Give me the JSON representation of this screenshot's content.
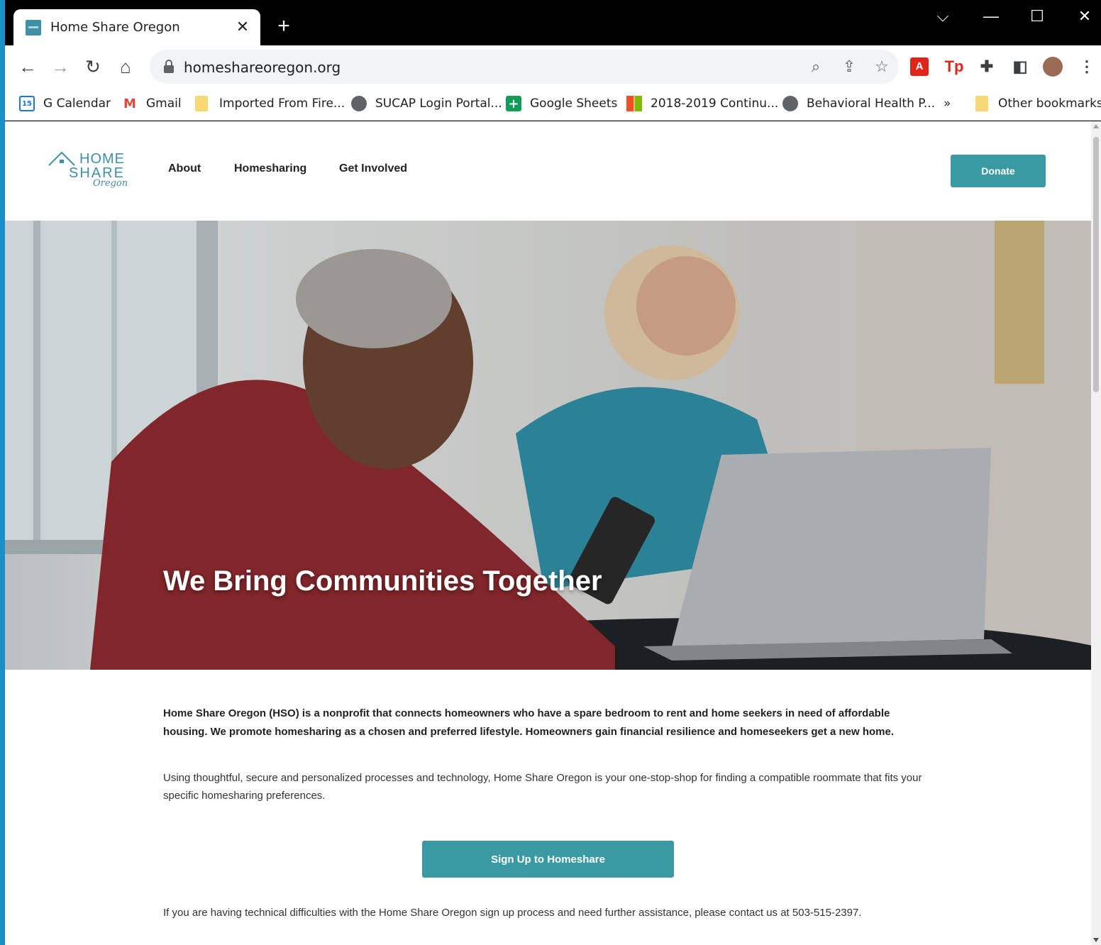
{
  "browser": {
    "tab_title": "Home Share Oregon",
    "tab_close": "✕",
    "new_tab": "+",
    "url": "homeshareoregon.org",
    "window_controls": {
      "dropdown": "⌵",
      "minimize": "—",
      "maximize": "☐",
      "close": "✕"
    }
  },
  "bookmarks": [
    {
      "label": "G Calendar",
      "icon": "calendar-icon",
      "badge": "15"
    },
    {
      "label": "Gmail",
      "icon": "gmail-icon",
      "badge": "M"
    },
    {
      "label": "Imported From Fire...",
      "icon": "folder-icon",
      "badge": ""
    },
    {
      "label": "SUCAP Login Portal...",
      "icon": "globe-icon",
      "badge": ""
    },
    {
      "label": "Google Sheets",
      "icon": "sheets-icon",
      "badge": "+"
    },
    {
      "label": "2018-2019 Continu...",
      "icon": "microsoft-icon",
      "badge": ""
    },
    {
      "label": "Behavioral Health P...",
      "icon": "globe-icon",
      "badge": ""
    },
    {
      "label": "»",
      "icon": "",
      "badge": ""
    },
    {
      "label": "Other bookmarks",
      "icon": "folder-icon",
      "badge": ""
    }
  ],
  "site": {
    "logo": {
      "line1": "HOME",
      "line2": "SHARE",
      "line3": "Oregon"
    },
    "nav": [
      "About",
      "Homesharing",
      "Get Involved"
    ],
    "donate_label": "Donate",
    "hero_title": "We Bring Communities Together",
    "intro": "Home Share Oregon (HSO) is a nonprofit that connects homeowners who have a spare bedroom to rent and home seekers in need of affordable housing. We promote homesharing as a chosen and preferred lifestyle. Homeowners gain financial resilience and homeseekers get a new home.",
    "body": "Using thoughtful, secure and personalized processes and technology, Home Share Oregon is your one-stop-shop for finding a compatible roommate that fits your specific homesharing preferences.",
    "signup_label": "Sign Up to Homeshare",
    "help": "If you are having technical difficulties with the Home Share Oregon sign up process and need further assistance, please contact us at 503-515-2397."
  },
  "colors": {
    "accent": "#3a9aa3",
    "brand": "#3f8fa8"
  }
}
